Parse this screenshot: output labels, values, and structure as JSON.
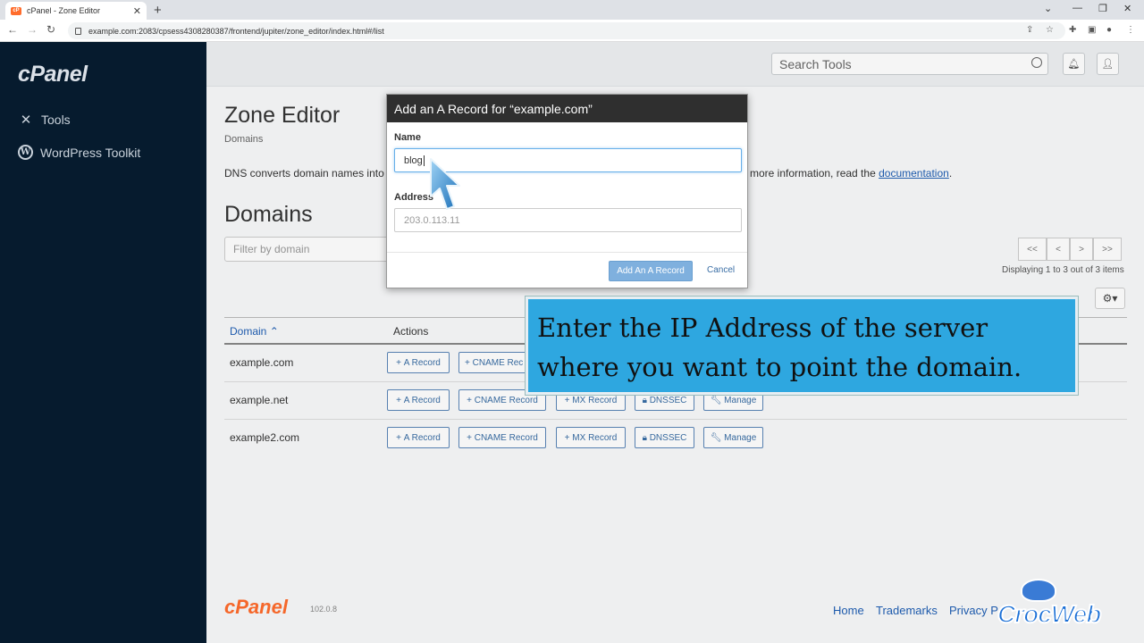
{
  "browser": {
    "tab_title": "cPanel - Zone Editor",
    "tab_favicon": "cP",
    "url": "example.com:2083/cpsess4308280387/frontend/jupiter/zone_editor/index.html#/list"
  },
  "sidebar": {
    "logo": "cPanel",
    "items": [
      {
        "label": "Tools",
        "icon": "tools-icon"
      },
      {
        "label": "WordPress Toolkit",
        "icon": "wordpress-icon"
      }
    ]
  },
  "header": {
    "search_placeholder": "Search Tools"
  },
  "page": {
    "title": "Zone Editor",
    "breadcrumb": "Domains",
    "description_left": "DNS converts domain names into",
    "description_right": "more information, read the",
    "doc_link": "documentation",
    "doc_suffix": ".",
    "section_title": "Domains",
    "filter_placeholder": "Filter by domain",
    "pager": [
      "<<",
      "<",
      ">",
      ">>"
    ],
    "displaying": "Displaying 1 to 3 out of 3 items"
  },
  "table": {
    "headers": {
      "domain": "Domain",
      "actions": "Actions"
    },
    "actions": [
      "A Record",
      "CNAME Record",
      "MX Record",
      "DNSSEC",
      "Manage"
    ],
    "rows": [
      {
        "domain": "example.com",
        "first_row_truncated_action": "CNAME Rec"
      },
      {
        "domain": "example.net"
      },
      {
        "domain": "example2.com"
      }
    ]
  },
  "modal": {
    "title": "Add an A Record for “example.com”",
    "name_label": "Name",
    "name_value": "blog",
    "address_label": "Address",
    "address_placeholder": "203.0.113.11",
    "submit_label": "Add An A Record",
    "cancel_label": "Cancel"
  },
  "annotation": {
    "text": "Enter the IP Address of the server where you want to point the domain.",
    "bg_color": "#2ea7e0"
  },
  "footer": {
    "logo": "cPanel",
    "version": "102.0.8",
    "links": [
      "Home",
      "Trademarks",
      "Privacy P"
    ]
  },
  "watermark": {
    "text": "CrocWeb"
  },
  "colors": {
    "sidebar_bg": "#061b2e",
    "accent": "#ff6c2c",
    "link": "#1f5eb3"
  }
}
